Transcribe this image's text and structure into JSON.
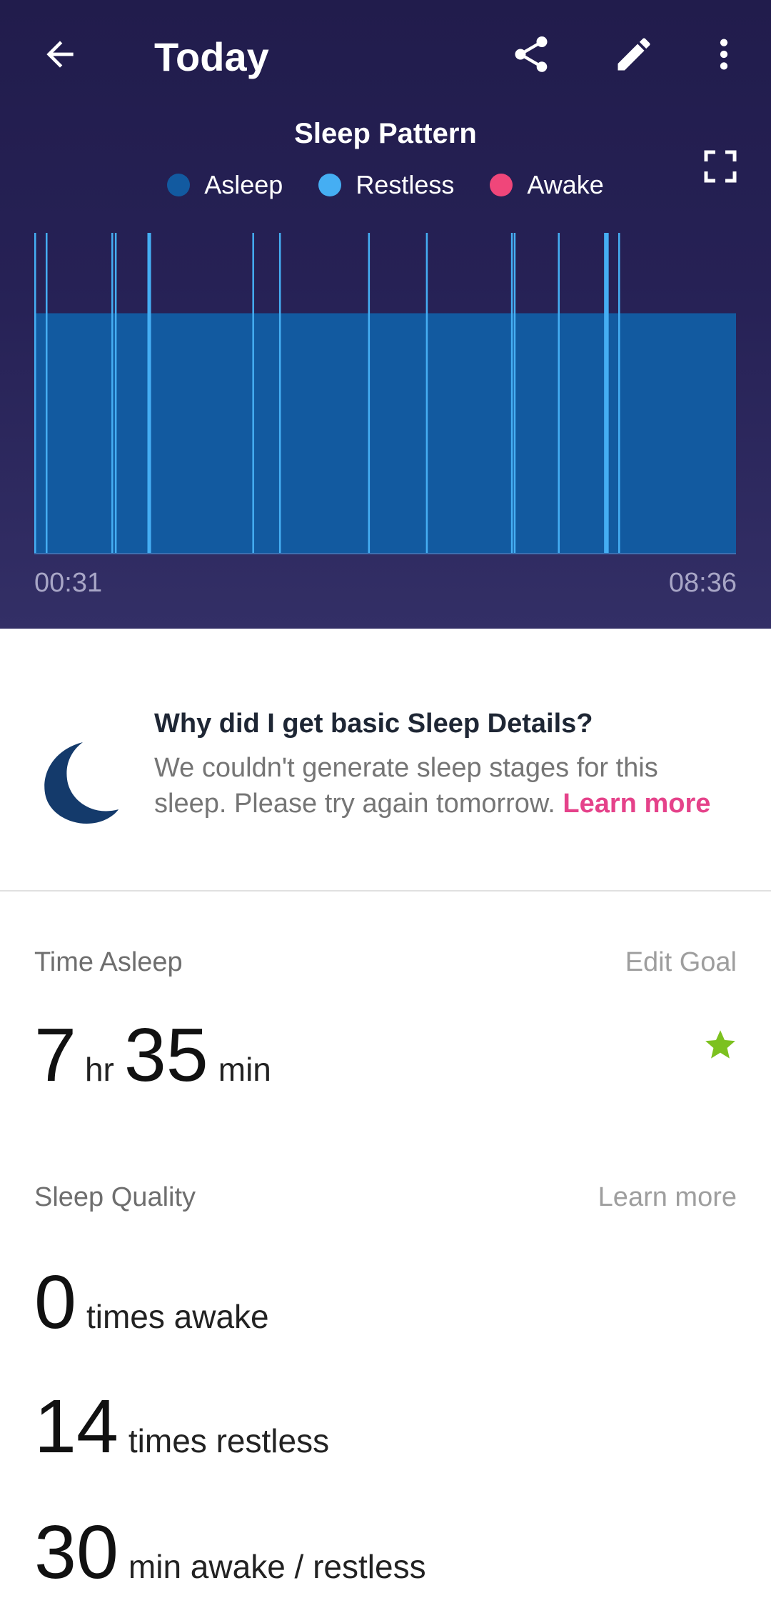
{
  "header": {
    "title": "Today",
    "icons": [
      "back-arrow-icon",
      "share-icon",
      "edit-pencil-icon",
      "more-vertical-icon",
      "fullscreen-icon"
    ]
  },
  "chart": {
    "title": "Sleep Pattern",
    "legend": [
      {
        "label": "Asleep",
        "color": "#125aa0"
      },
      {
        "label": "Restless",
        "color": "#45aef3"
      },
      {
        "label": "Awake",
        "color": "#f0467a"
      }
    ],
    "start_time": "00:31",
    "end_time": "08:36"
  },
  "chart_data": {
    "type": "area",
    "x_start": "00:31",
    "x_end": "08:36",
    "duration_minutes": 485,
    "asleep_level": 0.75,
    "restless_level": 1.0,
    "restless_events": [
      {
        "start_min": 0.0,
        "width_min": 0.5
      },
      {
        "start_min": 7.9,
        "width_min": 0.5
      },
      {
        "start_min": 53.3,
        "width_min": 0.5
      },
      {
        "start_min": 55.7,
        "width_min": 0.5
      },
      {
        "start_min": 78.2,
        "width_min": 2.5
      },
      {
        "start_min": 150.7,
        "width_min": 1.2
      },
      {
        "start_min": 169.2,
        "width_min": 0.5
      },
      {
        "start_min": 230.7,
        "width_min": 0.5
      },
      {
        "start_min": 270.7,
        "width_min": 0.8
      },
      {
        "start_min": 329.5,
        "width_min": 0.5
      },
      {
        "start_min": 331.4,
        "width_min": 0.5
      },
      {
        "start_min": 361.9,
        "width_min": 0.5
      },
      {
        "start_min": 393.8,
        "width_min": 3.2
      },
      {
        "start_min": 403.6,
        "width_min": 0.8
      }
    ]
  },
  "info": {
    "title": "Why did I get basic Sleep Details?",
    "body": "We couldn't generate sleep stages for this sleep. Please try again tomorrow.",
    "link": "Learn more",
    "icon": "moon-icon"
  },
  "time_asleep": {
    "label": "Time Asleep",
    "action": "Edit Goal",
    "hours": "7",
    "hours_unit": "hr",
    "minutes": "35",
    "minutes_unit": "min",
    "goal_icon": "star-icon",
    "goal_color": "#7cc11f"
  },
  "sleep_quality": {
    "label": "Sleep Quality",
    "action": "Learn more",
    "stats": [
      {
        "value": "0",
        "unit": "times awake"
      },
      {
        "value": "14",
        "unit": "times restless"
      },
      {
        "value": "30",
        "unit": "min awake / restless"
      }
    ]
  }
}
